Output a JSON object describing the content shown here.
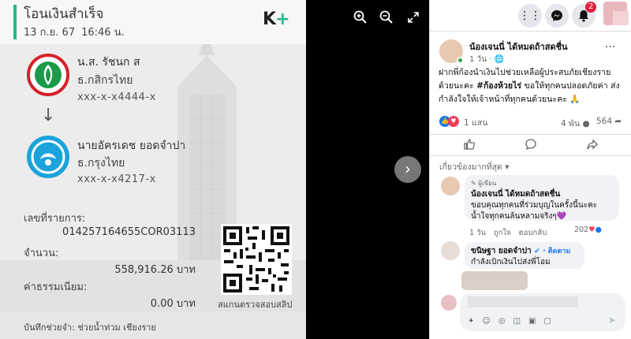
{
  "slip": {
    "title": "โอนเงินสำเร็จ",
    "date": "13 ก.ย. 67",
    "time": "16:46 น.",
    "brand_k": "K",
    "brand_plus": "+",
    "sender": {
      "name": "น.ส. รัชนก ส",
      "bank": "ธ.กสิกรไทย",
      "account": "xxx-x-x4444-x"
    },
    "receiver": {
      "name": "นายอัครเดช ยอดจำปา",
      "bank": "ธ.กรุงไทย",
      "account": "xxx-x-x4217-x"
    },
    "ref_label": "เลขที่รายการ:",
    "ref_value": "014257164655COR03113",
    "amount_label": "จำนวน:",
    "amount_value": "558,916.26 บาท",
    "fee_label": "ค่าธรรมเนียม:",
    "fee_value": "0.00 บาท",
    "qr_caption": "สแกนตรวจสอบสลิป",
    "memo": "บันทึกช่วยจำ: ช่วยน้ำท่วม เชียงราย",
    "colors": {
      "accent": "#1dba8a",
      "kbank_red": "#d72027",
      "ktb_blue": "#1ba3dc"
    }
  },
  "viewer": {
    "zoom_in_icon": "zoom-in-icon",
    "zoom_out_icon": "zoom-out-icon",
    "fullscreen_icon": "fullscreen-icon",
    "next_icon": "chevron-right-icon"
  },
  "facebook": {
    "notification_count": "2",
    "post": {
      "author": "น้องเจนนี่ ได้หมดถ้าสดชื่น",
      "time": "1 วัน ·",
      "text_before": "ฝากพี่ก้องนำเงินไปช่วยเหลือผู้ประสบภัยเชียงรายด้วยนะคะ ",
      "hashtag": "#ก้องห้วยไร่",
      "text_after": " ขอให้ทุกคนปลอดภัยค่า ส่งกำลังใจให้เจ้าหน้าที่ทุกคนด้วยนะคะ 🙏",
      "reactions": "1 แสน",
      "comments": "4 พัน",
      "shares": "564"
    },
    "sort_label": "เกี่ยวข้องมากที่สุด ▾",
    "comments": [
      {
        "tag": "✎ ผู้เขียน",
        "author": "น้องเจนนี่ ได้หมดถ้าสดชื่น",
        "text": "ขอบคุณทุกคนที่ร่วมบุญในครั้งนี้นะคะ น้ำใจทุกคนล้นหลามจริงๆ💜",
        "time": "1 วัน",
        "like": "ถูกใจ",
        "reply": "ตอบกลับ",
        "count": "202"
      },
      {
        "author": "ขนิษฐา ยอดจำปา",
        "follow": "· ติดตาม",
        "text": "กำลังเบิกเงินไปส่งพี่โอม"
      }
    ]
  }
}
